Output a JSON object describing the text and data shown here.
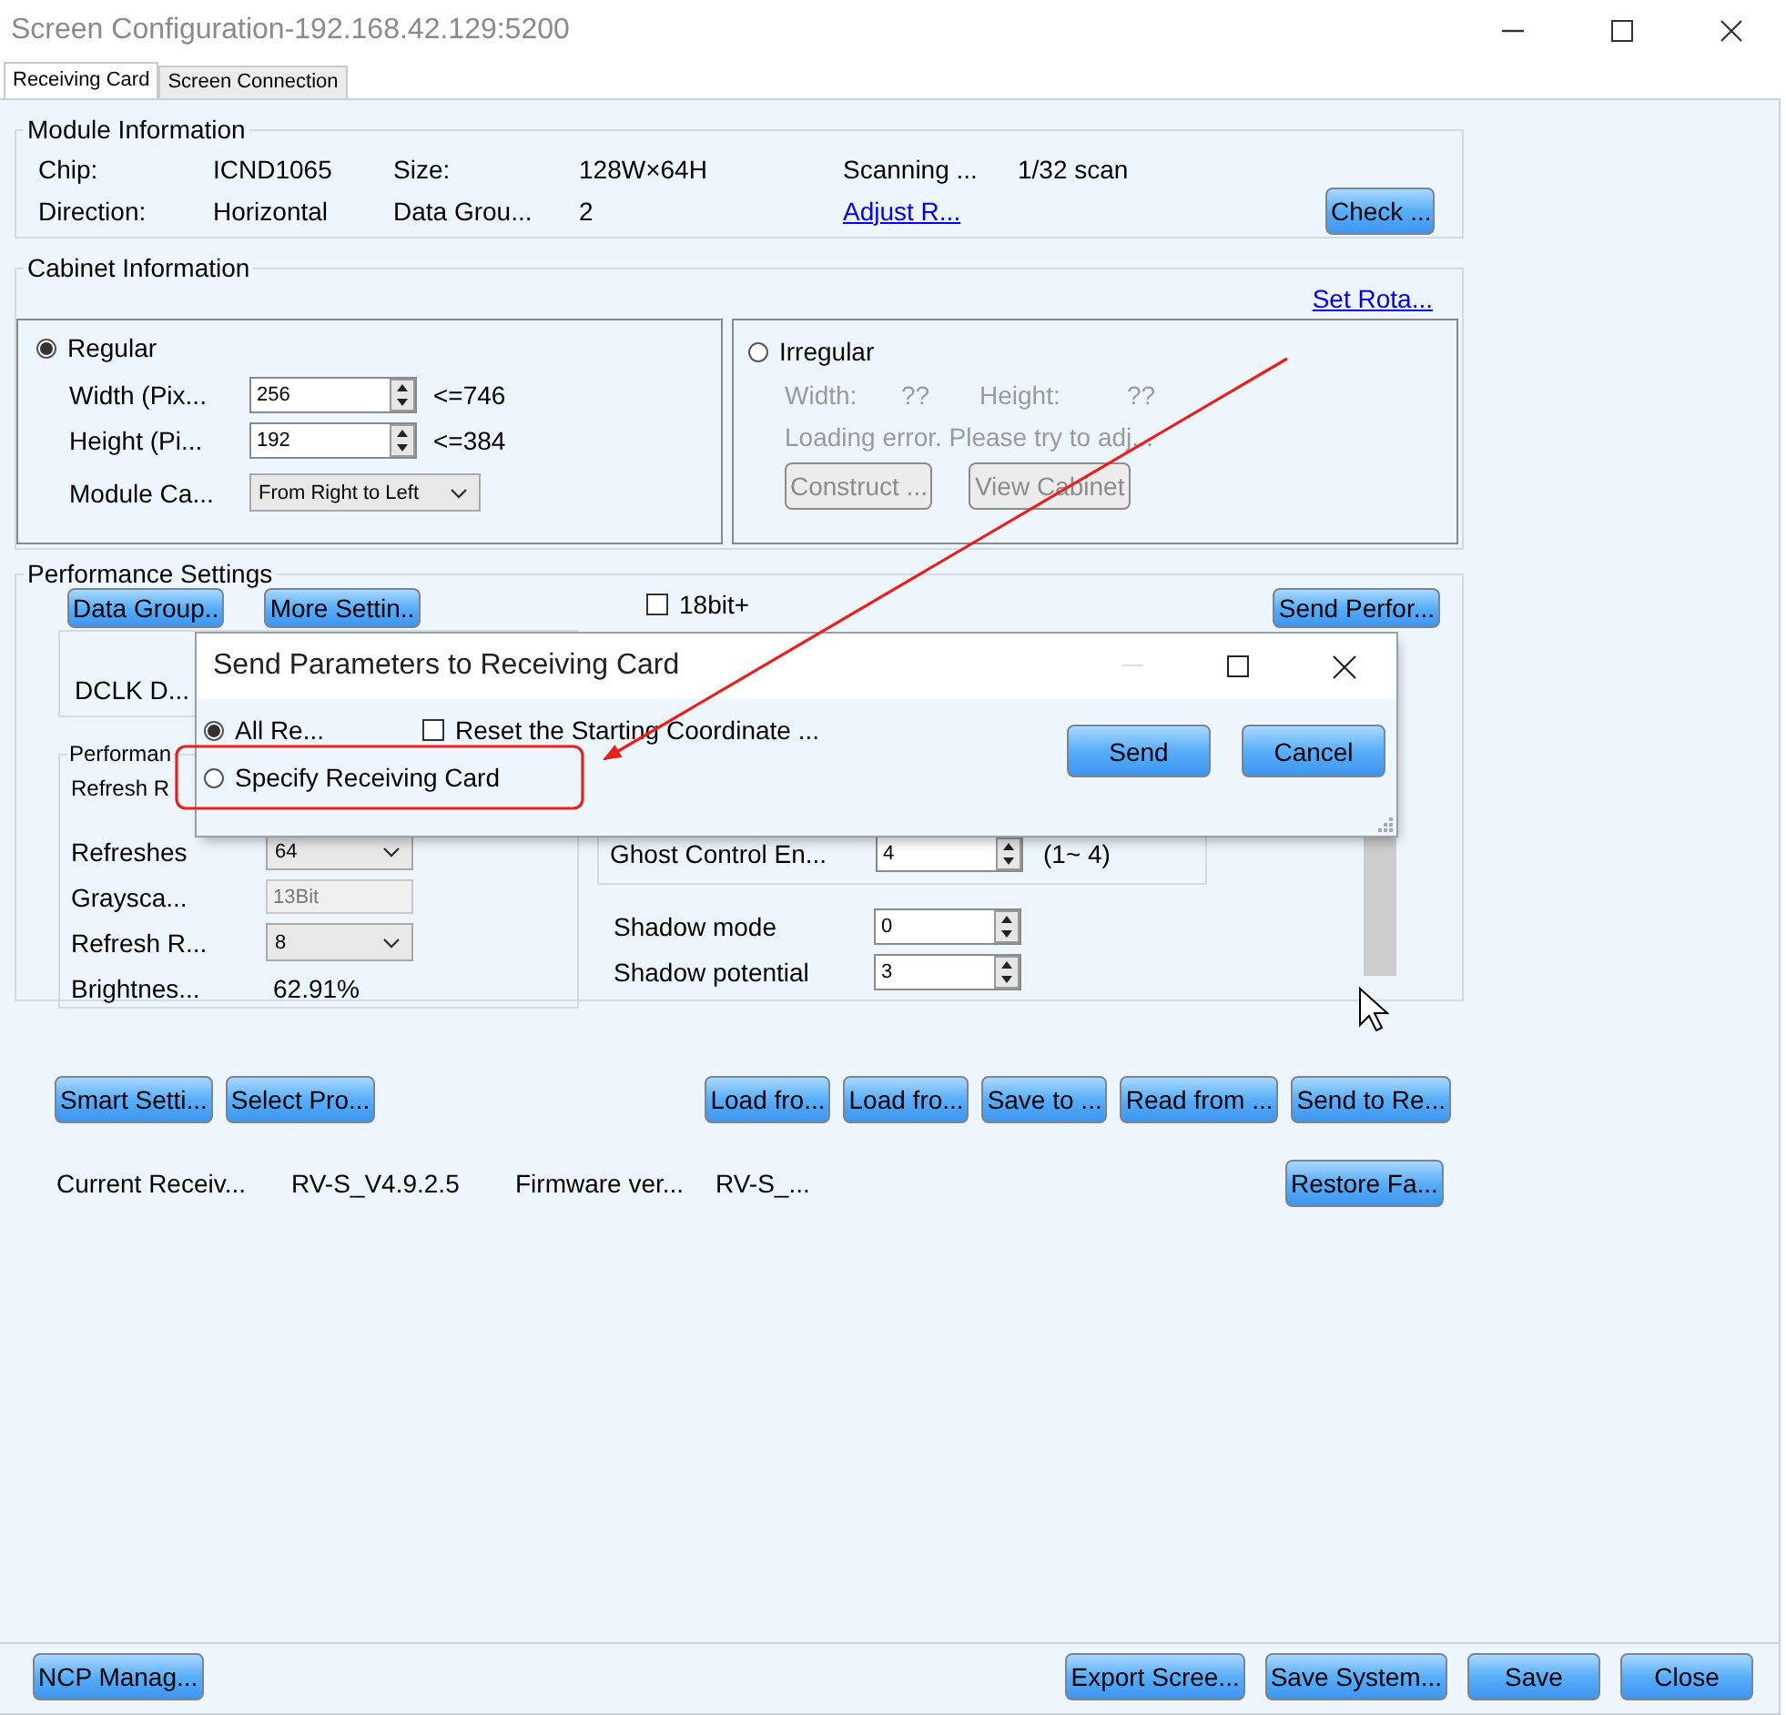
{
  "window": {
    "title": "Screen Configuration-192.168.42.129:5200"
  },
  "tabs": [
    {
      "label": "Receiving Card",
      "selected": true
    },
    {
      "label": "Screen Connection",
      "selected": false
    }
  ],
  "module_information": {
    "title": "Module Information",
    "fields": [
      {
        "label": "Chip:",
        "value": "ICND1065"
      },
      {
        "label": "Size:",
        "value": "128W×64H"
      },
      {
        "label": "Scanning ...",
        "value": "1/32 scan"
      },
      {
        "label": "Direction:",
        "value": "Horizontal"
      },
      {
        "label": "Data Grou...",
        "value": "2"
      }
    ],
    "link": "Adjust R...",
    "button": "Check ..."
  },
  "cabinet_information": {
    "title": "Cabinet Information",
    "link": "Set Rota...",
    "regular": {
      "label": "Regular",
      "selected": true,
      "fields": [
        {
          "label": "Width (Pix...",
          "value": "256",
          "limit": "<=746"
        },
        {
          "label": "Height (Pi...",
          "value": "192",
          "limit": "<=384"
        }
      ],
      "cascade": {
        "label": "Module Ca...",
        "value": "From Right to Left"
      }
    },
    "irregular": {
      "label": "Irregular",
      "selected": false,
      "width_label": "Width:",
      "width_value": "??",
      "height_label": "Height:",
      "height_value": "??",
      "message": "Loading error. Please try to adj...",
      "buttons": [
        "Construct ...",
        "View Cabinet"
      ]
    }
  },
  "performance_settings": {
    "title": "Performance Settings",
    "buttons": [
      "Data Group..",
      "More Settin.."
    ],
    "bit18": {
      "label": "18bit+",
      "checked": false
    },
    "send_button": "Send Perfor...",
    "dclk_label": "DCLK D...",
    "group_title": "Performan",
    "refresh_label": "Refresh R",
    "rows": [
      {
        "kind": "select",
        "label": "Refreshes",
        "value": "64"
      },
      {
        "kind": "readonly",
        "label": "Graysca...",
        "value": "13Bit"
      },
      {
        "kind": "select",
        "label": "Refresh R...",
        "value": "8"
      },
      {
        "kind": "text",
        "label": "Brightnes...",
        "value": "62.91%"
      }
    ],
    "ghost": {
      "label": "Ghost Control En...",
      "value": "4",
      "range": "(1~ 4)"
    },
    "shadow": [
      {
        "label": "Shadow mode",
        "value": "0"
      },
      {
        "label": "Shadow potential",
        "value": "3"
      }
    ]
  },
  "actions": {
    "left": [
      "Smart Setti...",
      "Select Pro..."
    ],
    "right": [
      "Load fro...",
      "Load fro...",
      "Save to ...",
      "Read from ...",
      "Send to Re..."
    ]
  },
  "receiver_info": [
    {
      "label": "Current Receiv...",
      "value": "RV-S_V4.9.2.5"
    },
    {
      "label": "Firmware ver...",
      "value": "RV-S_..."
    }
  ],
  "restore_button": "Restore Fa...",
  "footer": {
    "left": [
      "NCP Manag..."
    ],
    "right": [
      "Export Scree...",
      "Save System...",
      "Save",
      "Close"
    ]
  },
  "dialog": {
    "title": "Send Parameters to Receiving Card",
    "options": [
      {
        "label": "All Re...",
        "selected": true
      },
      {
        "label": "Specify Receiving Card",
        "selected": false
      }
    ],
    "reset_checkbox": {
      "label": "Reset the Starting Coordinate ...",
      "checked": false
    },
    "buttons": [
      "Send",
      "Cancel"
    ]
  }
}
